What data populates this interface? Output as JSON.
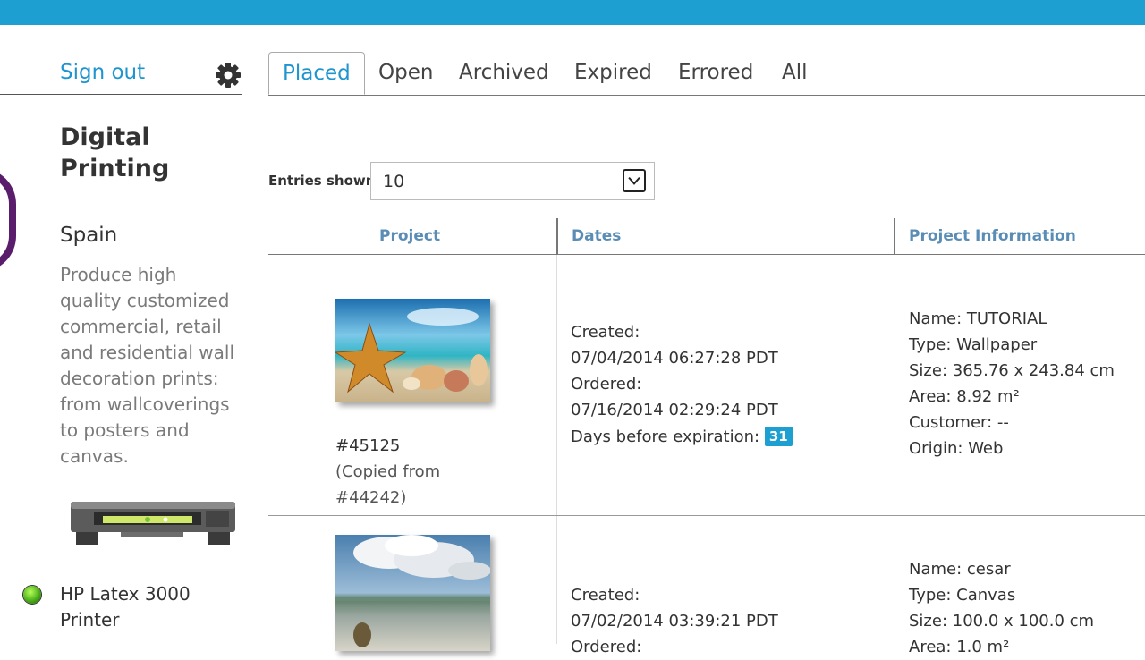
{
  "sidebar": {
    "sign_out": "Sign out",
    "brand_title": "Digital Printing",
    "region": "Spain",
    "description": "Produce high quality customized commercial, retail and residential wall decoration prints: from wallcoverings to posters and canvas.",
    "printer_name": "HP Latex 3000 Printer",
    "status_color": "#4caf1a"
  },
  "tabs": [
    {
      "label": "Placed",
      "active": true
    },
    {
      "label": "Open"
    },
    {
      "label": "Archived"
    },
    {
      "label": "Expired"
    },
    {
      "label": "Errored"
    },
    {
      "label": "All"
    }
  ],
  "entries": {
    "label": "Entries shown:",
    "value": "10"
  },
  "table": {
    "headers": [
      "Project",
      "Dates",
      "Project Information"
    ],
    "rows": [
      {
        "project_id": "#45125",
        "copied_line1": "(Copied from",
        "copied_line2": "#44242)",
        "created_label": "Created:",
        "created": "07/04/2014 06:27:28 PDT",
        "ordered_label": "Ordered:",
        "ordered": "07/16/2014 02:29:24 PDT",
        "expiration_label": "Days before expiration:",
        "expiration_days": "31",
        "name": "Name: TUTORIAL",
        "type": "Type: Wallpaper",
        "size": "Size: 365.76 x 243.84 cm",
        "area": "Area: 8.92 m²",
        "customer": "Customer: --",
        "origin": "Origin: Web"
      },
      {
        "created_label": "Created:",
        "created": "07/02/2014 03:39:21 PDT",
        "ordered_label": "Ordered:",
        "name": "Name: cesar",
        "type": "Type: Canvas",
        "size": "Size: 100.0 x 100.0 cm",
        "area": "Area: 1.0 m²"
      }
    ]
  },
  "colors": {
    "accent": "#1e9fd2",
    "header_text": "#5a8db5",
    "brand_purple": "#5a1d6b"
  }
}
